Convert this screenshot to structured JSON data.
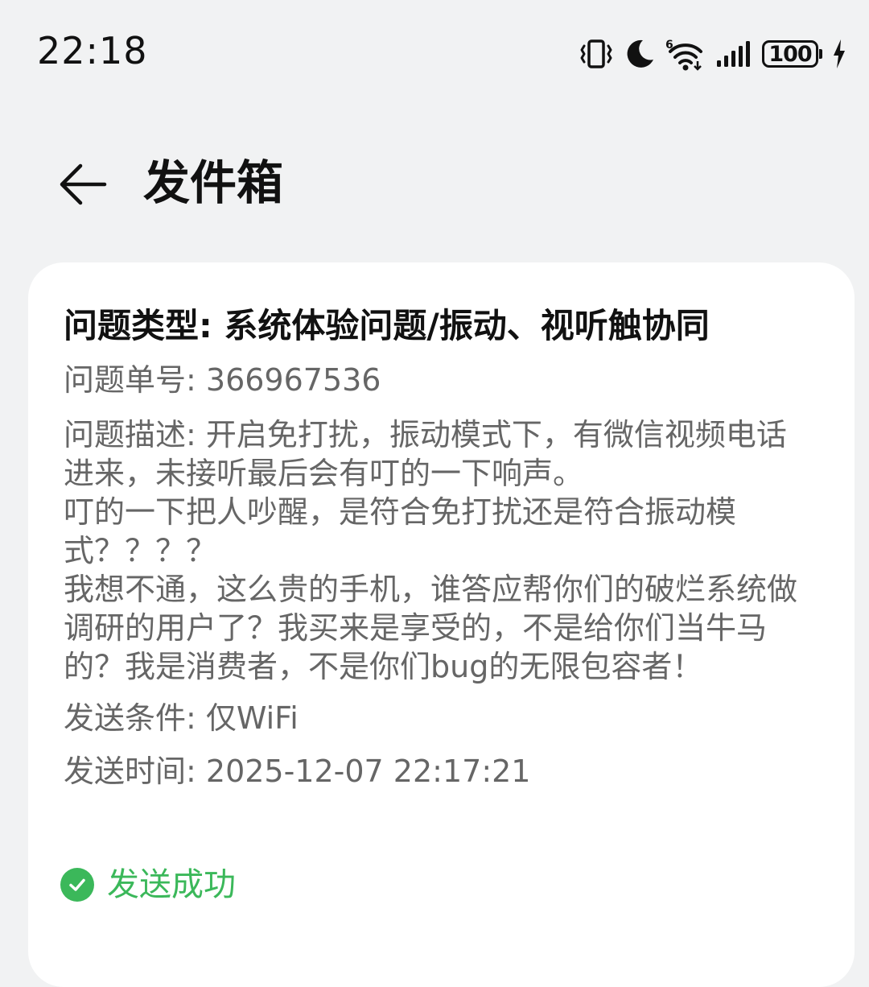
{
  "status_bar": {
    "time": "22:18",
    "battery": "100",
    "wifi_badge": "6",
    "icons": [
      "vibrate-icon",
      "moon-icon",
      "wifi-icon",
      "signal-icon",
      "battery-icon",
      "charging-icon"
    ]
  },
  "header": {
    "title": "发件箱"
  },
  "card": {
    "issue_type": "问题类型: 系统体验问题/振动、视听触协同",
    "issue_no_label": "问题单号: ",
    "issue_no_value": "366967536",
    "description_lines": [
      "问题描述: 开启免打扰，振动模式下，有微信视频电话",
      "进来，未接听最后会有叮的一下响声。",
      "叮的一下把人吵醒，是符合免打扰还是符合振动模",
      "式？？？？",
      "我想不通，这么贵的手机，谁答应帮你们的破烂系统做",
      "调研的用户了？我买来是享受的，不是给你们当牛马",
      "的？我是消费者，不是你们bug的无限包容者！"
    ],
    "send_condition_label": "发送条件: ",
    "send_condition_value": "仅WiFi",
    "send_time_label": "发送时间: ",
    "send_time_value": "2025-12-07 22:17:21",
    "status": "发送成功"
  },
  "colors": {
    "background": "#f1f2f3",
    "card": "#ffffff",
    "success": "#3bb85a",
    "secondary_text": "#666666",
    "primary_text": "#111111"
  }
}
